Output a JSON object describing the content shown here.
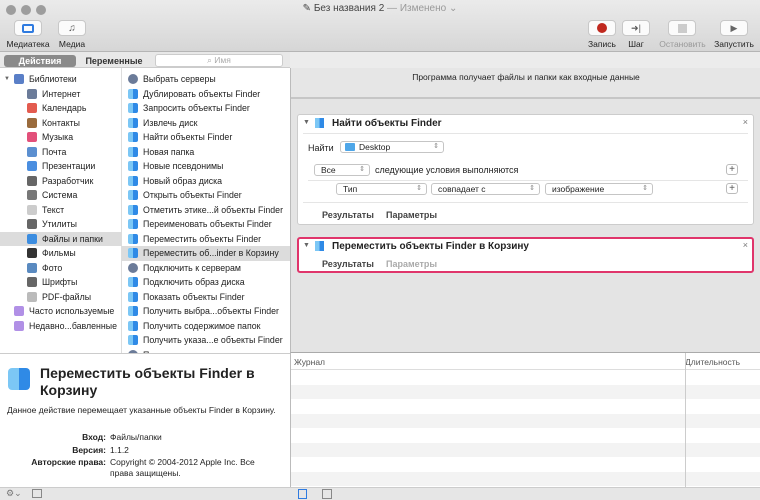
{
  "window": {
    "title": "Без названия 2",
    "status": "— Изменено ⌄"
  },
  "toolbar": {
    "library": "Медиатека",
    "media": "Медиа",
    "record": "Запись",
    "step": "Шаг",
    "stop": "Остановить",
    "run": "Запустить",
    "record_color": "#c0281e"
  },
  "tabs": {
    "actions": "Действия",
    "variables": "Переменные"
  },
  "search": {
    "placeholder": "Имя"
  },
  "library": [
    {
      "label": "Библиотеки",
      "color": "#5a7fc7"
    },
    {
      "label": "Интернет",
      "color": "#6b7b99"
    },
    {
      "label": "Календарь",
      "color": "#e35b4f"
    },
    {
      "label": "Контакты",
      "color": "#9a6b3c"
    },
    {
      "label": "Музыка",
      "color": "#e2507a"
    },
    {
      "label": "Почта",
      "color": "#5b8fd0"
    },
    {
      "label": "Презентации",
      "color": "#4a8ee0"
    },
    {
      "label": "Разработчик",
      "color": "#666"
    },
    {
      "label": "Система",
      "color": "#777"
    },
    {
      "label": "Текст",
      "color": "#ccc"
    },
    {
      "label": "Утилиты",
      "color": "#666"
    },
    {
      "label": "Файлы и папки",
      "color": "#3c8de0"
    },
    {
      "label": "Фильмы",
      "color": "#333"
    },
    {
      "label": "Фото",
      "color": "#5a8ac0"
    },
    {
      "label": "Шрифты",
      "color": "#666"
    },
    {
      "label": "PDF-файлы",
      "color": "#bbb"
    },
    {
      "label": "Часто используемые",
      "color": "#b190e6"
    },
    {
      "label": "Недавно...бавленные",
      "color": "#b190e6"
    }
  ],
  "library_selected": 11,
  "actions": [
    "Выбрать серверы",
    "Дублировать объекты Finder",
    "Запросить объекты Finder",
    "Извлечь диск",
    "Найти объекты Finder",
    "Новая папка",
    "Новые псевдонимы",
    "Новый образ диска",
    "Открыть объекты Finder",
    "Отметить этике...й объекты Finder",
    "Переименовать объекты Finder",
    "Переместить объекты Finder",
    "Переместить об...inder в Корзину",
    "Подключить к серверам",
    "Подключить образ диска",
    "Показать объекты Finder",
    "Получить выбра...объекты Finder",
    "Получить содержимое папок",
    "Получить указа...е объекты Finder",
    "Получить указанные серверы"
  ],
  "actions_selected": 12,
  "description": {
    "title": "Переместить объекты Finder в Корзину",
    "text": "Данное действие перемещает указанные объекты Finder в Корзину.",
    "input_label": "Вход:",
    "input": "Файлы/папки",
    "version_label": "Версия:",
    "version": "1.1.2",
    "copyright_label": "Авторские права:",
    "copyright": "Copyright © 2004-2012 Apple Inc. Все права защищены."
  },
  "workflow": {
    "input_note": "Программа получает файлы и папки как входные данные",
    "action1": {
      "title": "Найти объекты Finder",
      "find_label": "Найти",
      "location": "Desktop",
      "match": "Все",
      "conditions_text": "следующие условия выполняются",
      "field": "Тип",
      "operator": "совпадает с",
      "value": "изображение",
      "results": "Результаты",
      "options": "Параметры"
    },
    "action2": {
      "title": "Переместить объекты Finder в Корзину",
      "results": "Результаты",
      "options": "Параметры",
      "highlight_color": "#e0356b"
    }
  },
  "log": {
    "col_log": "Журнал",
    "col_duration": "Длительность"
  }
}
